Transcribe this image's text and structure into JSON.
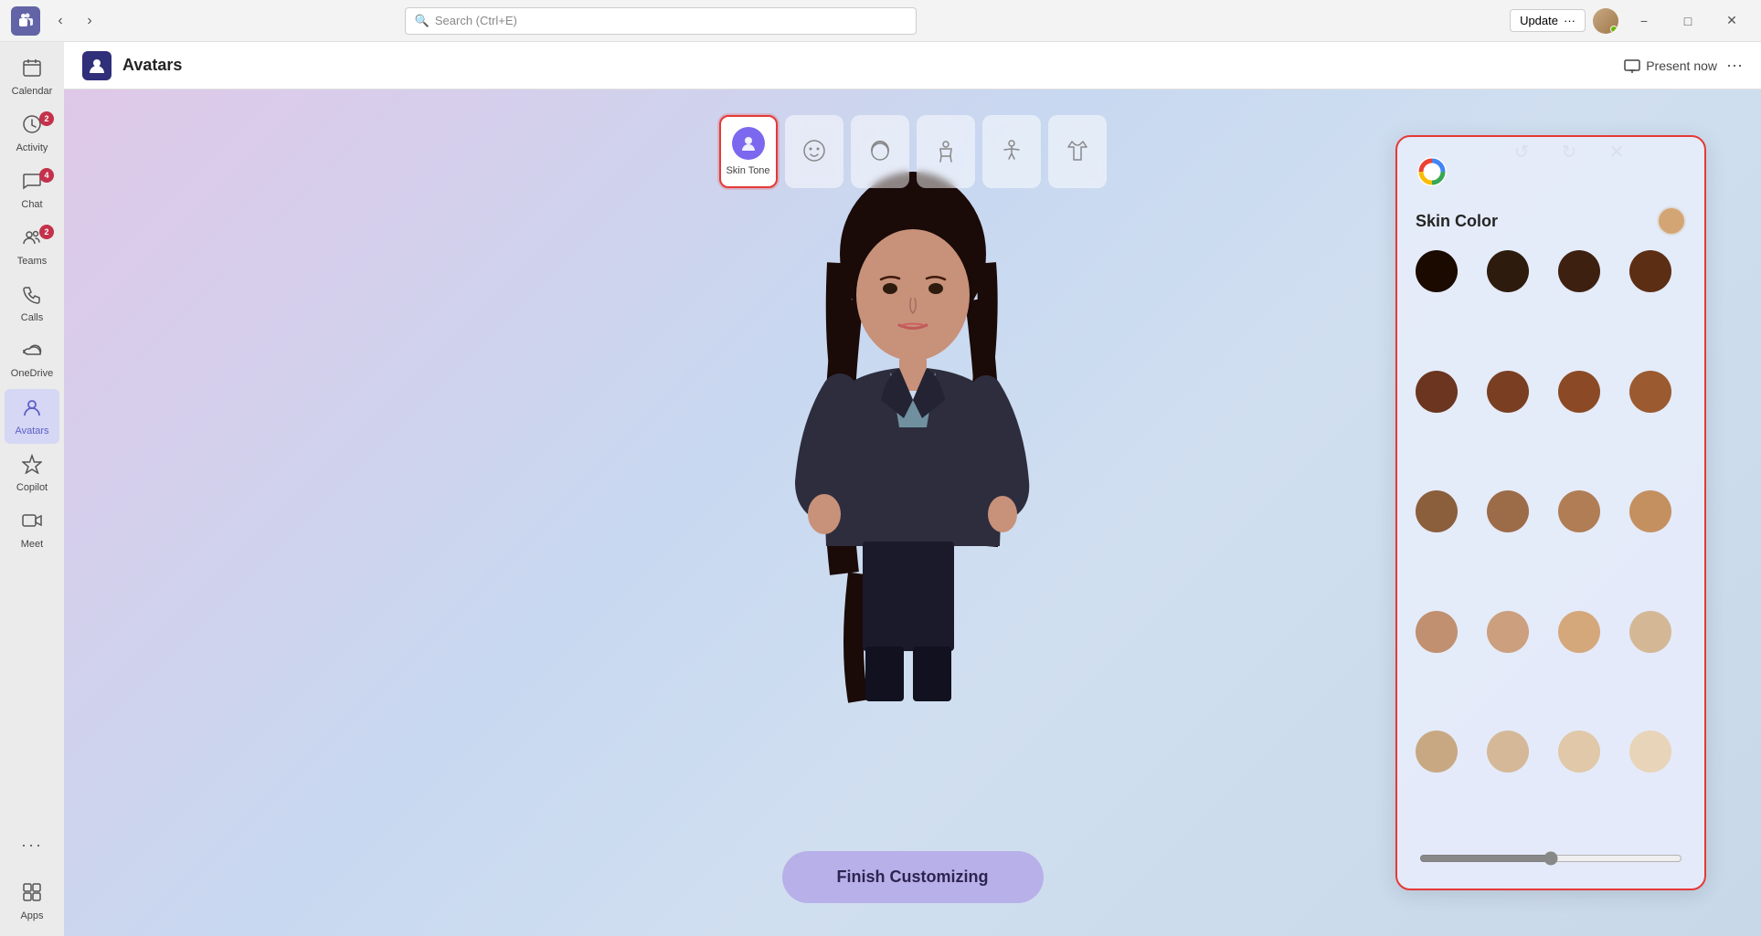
{
  "titlebar": {
    "search_placeholder": "Search (Ctrl+E)",
    "update_label": "Update",
    "update_more": "···",
    "minimize_label": "−",
    "maximize_label": "□",
    "close_label": "✕"
  },
  "sidebar": {
    "items": [
      {
        "id": "calendar",
        "label": "Calendar",
        "icon": "📅",
        "badge": null,
        "active": false
      },
      {
        "id": "activity",
        "label": "Activity",
        "icon": "🔔",
        "badge": "2",
        "active": false
      },
      {
        "id": "chat",
        "label": "Chat",
        "icon": "💬",
        "badge": "4",
        "active": false
      },
      {
        "id": "teams",
        "label": "Teams",
        "icon": "👥",
        "badge": "2",
        "active": false
      },
      {
        "id": "calls",
        "label": "Calls",
        "icon": "📞",
        "badge": null,
        "active": false
      },
      {
        "id": "onedrive",
        "label": "OneDrive",
        "icon": "☁",
        "badge": null,
        "active": false
      },
      {
        "id": "avatars",
        "label": "Avatars",
        "icon": "👤",
        "badge": null,
        "active": true
      },
      {
        "id": "copilot",
        "label": "Copilot",
        "icon": "⬡",
        "badge": null,
        "active": false
      },
      {
        "id": "meet",
        "label": "Meet",
        "icon": "📷",
        "badge": null,
        "active": false
      }
    ],
    "bottom_items": [
      {
        "id": "apps",
        "label": "Apps",
        "icon": "⊞",
        "badge": null
      }
    ],
    "more_label": "···"
  },
  "app_header": {
    "icon": "🧍",
    "title": "Avatars",
    "present_now_label": "Present now",
    "more_icon": "···"
  },
  "toolbar": {
    "buttons": [
      {
        "id": "skin-tone",
        "label": "Skin Tone",
        "active": true
      },
      {
        "id": "face",
        "label": "",
        "active": false
      },
      {
        "id": "hair",
        "label": "",
        "active": false
      },
      {
        "id": "body",
        "label": "",
        "active": false
      },
      {
        "id": "pose",
        "label": "",
        "active": false
      },
      {
        "id": "outfit",
        "label": "",
        "active": false
      }
    ]
  },
  "skin_panel": {
    "title": "Skin Color",
    "selected_color": "#d4a574",
    "colors": [
      "#1a0a00",
      "#2d1b0e",
      "#3d2010",
      "#5c2e14",
      "#6b3520",
      "#7a3f22",
      "#8b4a25",
      "#9b5a30",
      "#8b5e3c",
      "#9c6b48",
      "#b07d55",
      "#c49060",
      "#c09070",
      "#cc9f7e",
      "#d4a87a",
      "#d4b896",
      "#c8a882",
      "#d4b898",
      "#e0c8a8",
      "#e8d4b8"
    ]
  },
  "finish_btn": {
    "label": "Finish Customizing"
  },
  "controls": {
    "undo": "↺",
    "redo": "↻",
    "close": "✕"
  }
}
